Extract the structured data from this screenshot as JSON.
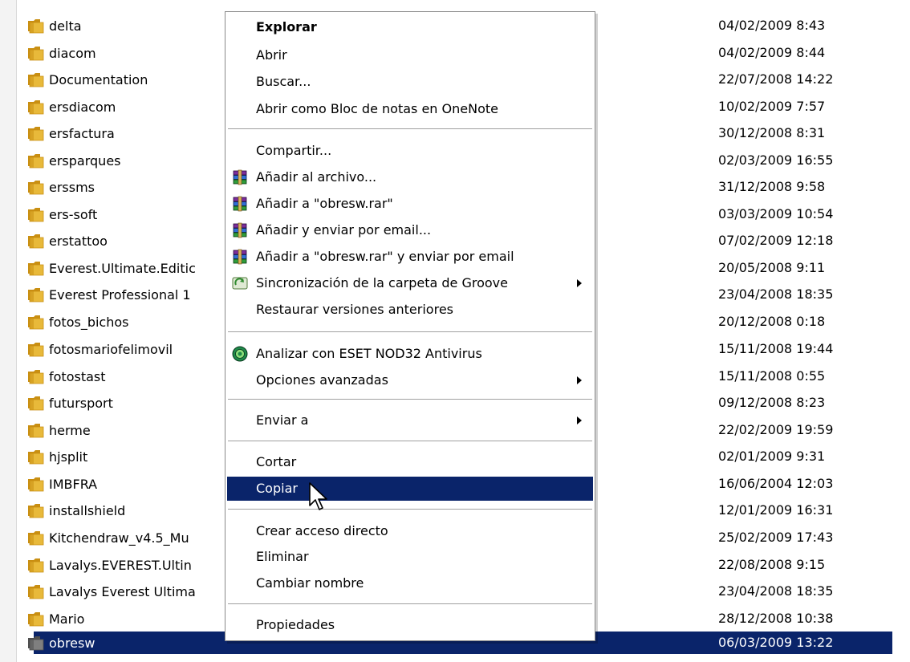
{
  "files": [
    {
      "name": "delta",
      "date": "04/02/2009 8:43"
    },
    {
      "name": "diacom",
      "date": "04/02/2009 8:44"
    },
    {
      "name": "Documentation",
      "date": "22/07/2008 14:22"
    },
    {
      "name": "ersdiacom",
      "date": "10/02/2009 7:57"
    },
    {
      "name": "ersfactura",
      "date": "30/12/2008 8:31"
    },
    {
      "name": "ersparques",
      "date": "02/03/2009 16:55"
    },
    {
      "name": "erssms",
      "date": "31/12/2008 9:58"
    },
    {
      "name": "ers-soft",
      "date": "03/03/2009 10:54"
    },
    {
      "name": "erstattoo",
      "date": "07/02/2009 12:18"
    },
    {
      "name": "Everest.Ultimate.Editic",
      "date": "20/05/2008 9:11"
    },
    {
      "name": "Everest Professional 1",
      "date": "23/04/2008 18:35"
    },
    {
      "name": "fotos_bichos",
      "date": "20/12/2008 0:18"
    },
    {
      "name": "fotosmariofelimovil",
      "date": "15/11/2008 19:44"
    },
    {
      "name": "fotostast",
      "date": "15/11/2008 0:55"
    },
    {
      "name": "futursport",
      "date": "09/12/2008 8:23"
    },
    {
      "name": "herme",
      "date": "22/02/2009 19:59"
    },
    {
      "name": "hjsplit",
      "date": "02/01/2009 9:31"
    },
    {
      "name": "IMBFRA",
      "date": "16/06/2004 12:03"
    },
    {
      "name": "installshield",
      "date": "12/01/2009 16:31"
    },
    {
      "name": "Kitchendraw_v4.5_Mu",
      "date": "25/02/2009 17:43"
    },
    {
      "name": "Lavalys.EVEREST.Ultin",
      "date": "22/08/2008 9:15"
    },
    {
      "name": "Lavalys Everest Ultima",
      "date": "23/04/2008 18:35"
    },
    {
      "name": "Mario",
      "date": "28/12/2008 10:38"
    },
    {
      "name": "obresw",
      "date": "06/03/2009 13:22",
      "selected": true
    }
  ],
  "context_menu": {
    "items": [
      {
        "label": "Explorar",
        "bold": true
      },
      {
        "label": "Abrir"
      },
      {
        "label": "Buscar..."
      },
      {
        "label": "Abrir como Bloc de notas en OneNote"
      },
      {
        "label": "Compartir..."
      },
      {
        "label": "Añadir al archivo...",
        "icon": "winrar-icon"
      },
      {
        "label": "Añadir a \"obresw.rar\"",
        "icon": "winrar-icon"
      },
      {
        "label": "Añadir y enviar por email...",
        "icon": "winrar-icon"
      },
      {
        "label": "Añadir a \"obresw.rar\" y enviar por email",
        "icon": "winrar-icon"
      },
      {
        "label": "Sincronización de la carpeta de Groove",
        "icon": "groove-icon",
        "submenu": true
      },
      {
        "label": "Restaurar versiones anteriores"
      },
      {
        "label": "Analizar con ESET NOD32 Antivirus",
        "icon": "eset-nod32-icon"
      },
      {
        "label": "Opciones avanzadas",
        "submenu": true
      },
      {
        "label": "Enviar a",
        "submenu": true
      },
      {
        "label": "Cortar"
      },
      {
        "label": "Copiar",
        "highlighted": true
      },
      {
        "label": "Crear acceso directo"
      },
      {
        "label": "Eliminar"
      },
      {
        "label": "Cambiar nombre"
      },
      {
        "label": "Propiedades"
      }
    ]
  },
  "colors": {
    "selection": "#0a246a",
    "folder": "#e8b93a",
    "folder_dark": "#c98f12"
  }
}
